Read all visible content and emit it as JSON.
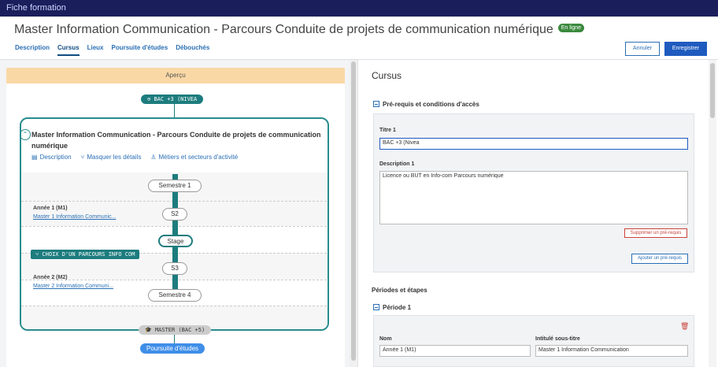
{
  "app": {
    "title": "Fiche formation"
  },
  "header": {
    "title": "Master Information Communication - Parcours Conduite de projets de communication numérique",
    "status_badge": "En ligne",
    "tabs": [
      {
        "label": "Description"
      },
      {
        "label": "Cursus"
      },
      {
        "label": "Lieux"
      },
      {
        "label": "Poursuite d'études"
      },
      {
        "label": "Débouchés"
      }
    ],
    "cancel_label": "Annuler",
    "save_label": "Enregistrer"
  },
  "preview": {
    "bar_label": "Aperçu",
    "entry_pill": "BAC +3 (NIVEA",
    "card_title": "Master Information Communication - Parcours Conduite de projets de communication numérique",
    "links": {
      "description": "Description",
      "hide_details": "Masquer les détails",
      "jobs": "Métiers et secteurs d'activité"
    },
    "nodes": {
      "sem1": "Semestre 1",
      "s2": "S2",
      "stage": "Stage",
      "s3": "S3",
      "sem4": "Semestre 4"
    },
    "year1": {
      "label": "Année 1 (M1)",
      "link": "Master 1 Information Communic..."
    },
    "choice_label": "CHOIX D'UN PARCOURS INFO COM",
    "year2": {
      "label": "Année 2 (M2)",
      "link": "Master 2 Information Communi..."
    },
    "exit_pill": "MASTER (BAC +5)",
    "further_pill": "Poursuite d'études"
  },
  "form": {
    "title": "Cursus",
    "prereq_section": "Pré-requis et conditions d'accès",
    "titre_label": "Titre 1",
    "titre_value": "BAC +3 (Nivea",
    "description_label": "Description 1",
    "description_value": "Licence ou BUT en Info-com Parcours numérique",
    "delete_prereq": "Supprimer un pré-requis",
    "add_prereq": "Ajouter un pré-requis",
    "periods_section": "Périodes et étapes",
    "period1": "Période 1",
    "nom_label": "Nom",
    "nom_value": "Année 1 (M1)",
    "subtitle_label": "Intitulé sous-titre",
    "subtitle_value": "Master 1 Information Communication"
  },
  "colors": {
    "topbar": "#1a1f5c",
    "teal": "#1d7c7e",
    "primary": "#1f5bbf",
    "danger": "#c9433a",
    "preview_bar": "#fad8a6"
  }
}
